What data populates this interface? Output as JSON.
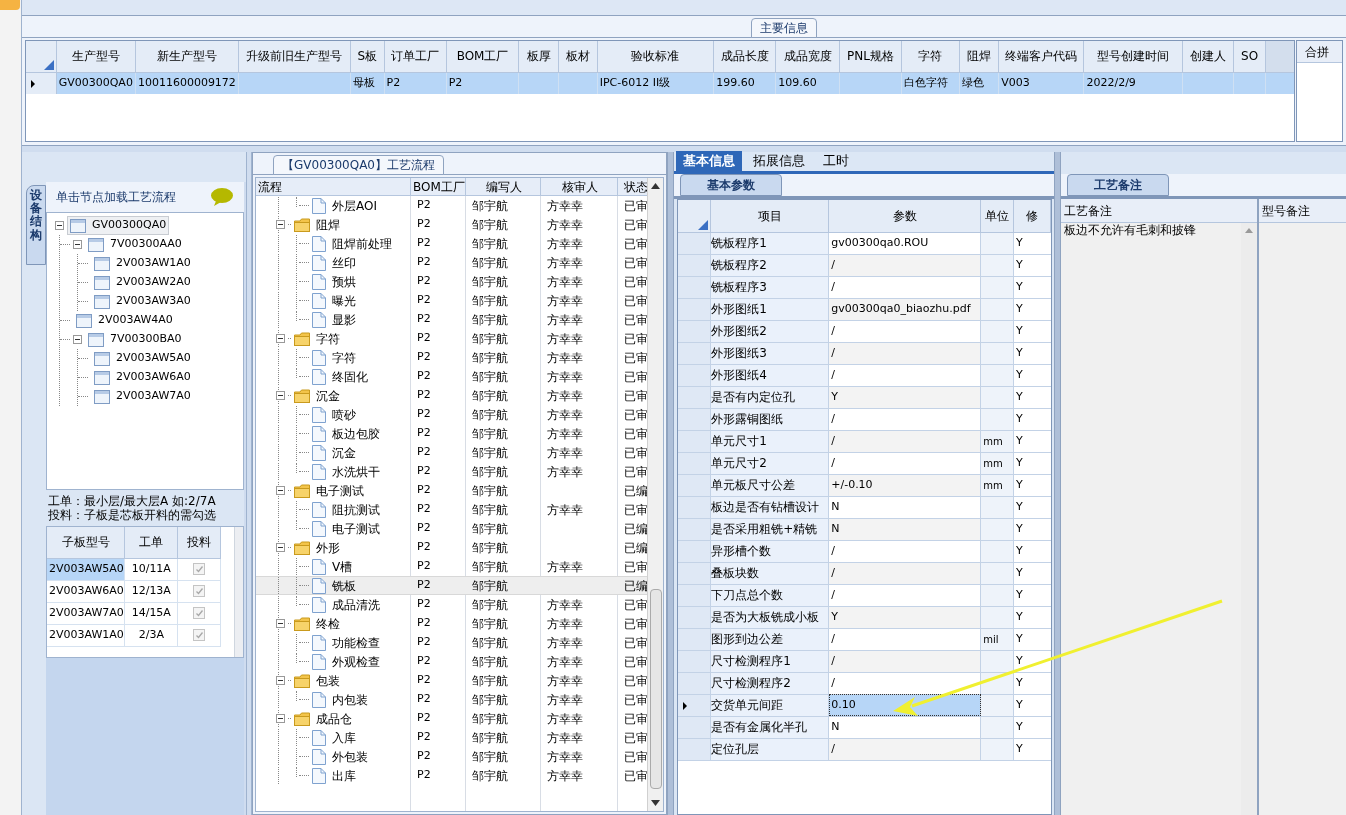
{
  "main_info": {
    "title": "主要信息",
    "columns": [
      "生产型号",
      "新生产型号",
      "升级前旧生产型号",
      "S板",
      "订单工厂",
      "BOM工厂",
      "板厚",
      "板材",
      "验收标准",
      "成品长度",
      "成品宽度",
      "PNL规格",
      "字符",
      "阻焊",
      "终端客户代码",
      "型号创建时间",
      "创建人",
      "SO"
    ],
    "rows": [
      {
        "selected": true,
        "cells": [
          "GV00300QA0",
          "10011600009172",
          "",
          "母板",
          "P2",
          "P2",
          "",
          "",
          "IPC-6012 II级",
          "199.60",
          "109.60",
          "",
          "白色字符",
          "绿色",
          "V003",
          "2022/2/9",
          "",
          ""
        ]
      }
    ]
  },
  "merge_panel": {
    "title": "合拼"
  },
  "structure_tab": {
    "label": "设备结构"
  },
  "structure": {
    "header": "单击节点加载工艺流程",
    "tree": [
      {
        "label": "GV00300QA0",
        "selected": true,
        "expanded": true,
        "children": [
          {
            "label": "7V00300AA0",
            "selected": false,
            "expanded": true,
            "children": [
              {
                "label": "2V003AW1A0",
                "selected": false
              },
              {
                "label": "2V003AW2A0",
                "selected": false
              },
              {
                "label": "2V003AW3A0",
                "selected": false
              }
            ]
          },
          {
            "label": "2V003AW4A0",
            "selected": false
          },
          {
            "label": "7V00300BA0",
            "selected": false,
            "expanded": true,
            "children": [
              {
                "label": "2V003AW5A0",
                "selected": false
              },
              {
                "label": "2V003AW6A0",
                "selected": false
              },
              {
                "label": "2V003AW7A0",
                "selected": false
              }
            ]
          }
        ]
      }
    ]
  },
  "note": [
    "工单：最小层/最大层A 如:2/7A",
    "投料：子板是芯板开料的需勾选"
  ],
  "sub_boards": {
    "columns": [
      "子板型号",
      "工单",
      "投料"
    ],
    "rows": [
      {
        "model": "2V003AW5A0",
        "order": "10/11A",
        "feed": true,
        "selected": true
      },
      {
        "model": "2V003AW6A0",
        "order": "12/13A",
        "feed": true,
        "selected": false
      },
      {
        "model": "2V003AW7A0",
        "order": "14/15A",
        "feed": true,
        "selected": false
      },
      {
        "model": "2V003AW1A0",
        "order": "2/3A",
        "feed": true,
        "selected": false
      }
    ]
  },
  "flow": {
    "title": "【GV00300QA0】工艺流程",
    "columns": [
      "流程",
      "BOM工厂",
      "编写人",
      "核审人",
      "状态"
    ],
    "items": [
      {
        "kind": "continued",
        "children": [
          {
            "name": "外层AOI",
            "bom": "P2",
            "writer": "邹宇航",
            "reviewer": "方幸幸",
            "status": "已审",
            "selected": false
          }
        ]
      },
      {
        "kind": "group",
        "name": "阻焊",
        "bom": "P2",
        "writer": "邹宇航",
        "reviewer": "方幸幸",
        "status": "已审",
        "selected": false,
        "expanded": true,
        "children": [
          {
            "name": "阻焊前处理",
            "bom": "P2",
            "writer": "邹宇航",
            "reviewer": "方幸幸",
            "status": "已审",
            "selected": false
          },
          {
            "name": "丝印",
            "bom": "P2",
            "writer": "邹宇航",
            "reviewer": "方幸幸",
            "status": "已审",
            "selected": false
          },
          {
            "name": "预烘",
            "bom": "P2",
            "writer": "邹宇航",
            "reviewer": "方幸幸",
            "status": "已审",
            "selected": false
          },
          {
            "name": "曝光",
            "bom": "P2",
            "writer": "邹宇航",
            "reviewer": "方幸幸",
            "status": "已审",
            "selected": false
          },
          {
            "name": "显影",
            "bom": "P2",
            "writer": "邹宇航",
            "reviewer": "方幸幸",
            "status": "已审",
            "selected": false
          }
        ]
      },
      {
        "kind": "group",
        "name": "字符",
        "bom": "P2",
        "writer": "邹宇航",
        "reviewer": "方幸幸",
        "status": "已审",
        "selected": false,
        "expanded": true,
        "children": [
          {
            "name": "字符",
            "bom": "P2",
            "writer": "邹宇航",
            "reviewer": "方幸幸",
            "status": "已审",
            "selected": false
          },
          {
            "name": "终固化",
            "bom": "P2",
            "writer": "邹宇航",
            "reviewer": "方幸幸",
            "status": "已审",
            "selected": false
          }
        ]
      },
      {
        "kind": "group",
        "name": "沉金",
        "bom": "P2",
        "writer": "邹宇航",
        "reviewer": "方幸幸",
        "status": "已审",
        "selected": false,
        "expanded": true,
        "children": [
          {
            "name": "喷砂",
            "bom": "P2",
            "writer": "邹宇航",
            "reviewer": "方幸幸",
            "status": "已审",
            "selected": false
          },
          {
            "name": "板边包胶",
            "bom": "P2",
            "writer": "邹宇航",
            "reviewer": "方幸幸",
            "status": "已审",
            "selected": false
          },
          {
            "name": "沉金",
            "bom": "P2",
            "writer": "邹宇航",
            "reviewer": "方幸幸",
            "status": "已审",
            "selected": false
          },
          {
            "name": "水洗烘干",
            "bom": "P2",
            "writer": "邹宇航",
            "reviewer": "方幸幸",
            "status": "已审",
            "selected": false
          }
        ]
      },
      {
        "kind": "group",
        "name": "电子测试",
        "bom": "P2",
        "writer": "邹宇航",
        "status": "已编",
        "selected": false,
        "expanded": true,
        "children": [
          {
            "name": "阻抗测试",
            "bom": "P2",
            "writer": "邹宇航",
            "reviewer": "方幸幸",
            "status": "已审",
            "selected": false
          },
          {
            "name": "电子测试",
            "bom": "P2",
            "writer": "邹宇航",
            "status": "已编",
            "selected": false
          }
        ]
      },
      {
        "kind": "group",
        "name": "外形",
        "bom": "P2",
        "writer": "邹宇航",
        "status": "已编",
        "selected": false,
        "expanded": true,
        "children": [
          {
            "name": "V槽",
            "bom": "P2",
            "writer": "邹宇航",
            "reviewer": "方幸幸",
            "status": "已审",
            "selected": false
          },
          {
            "name": "铣板",
            "bom": "P2",
            "writer": "邹宇航",
            "status": "已编",
            "selected": true
          },
          {
            "name": "成品清洗",
            "bom": "P2",
            "writer": "邹宇航",
            "reviewer": "方幸幸",
            "status": "已审",
            "selected": false
          }
        ]
      },
      {
        "kind": "group",
        "name": "终检",
        "bom": "P2",
        "writer": "邹宇航",
        "reviewer": "方幸幸",
        "status": "已审",
        "selected": false,
        "expanded": true,
        "children": [
          {
            "name": "功能检查",
            "bom": "P2",
            "writer": "邹宇航",
            "reviewer": "方幸幸",
            "status": "已审",
            "selected": false
          },
          {
            "name": "外观检查",
            "bom": "P2",
            "writer": "邹宇航",
            "reviewer": "方幸幸",
            "status": "已审",
            "selected": false
          }
        ]
      },
      {
        "kind": "group",
        "name": "包装",
        "bom": "P2",
        "writer": "邹宇航",
        "reviewer": "方幸幸",
        "status": "已审",
        "selected": false,
        "expanded": true,
        "children": [
          {
            "name": "内包装",
            "bom": "P2",
            "writer": "邹宇航",
            "reviewer": "方幸幸",
            "status": "已审",
            "selected": false
          }
        ]
      },
      {
        "kind": "group",
        "name": "成品仓",
        "bom": "P2",
        "writer": "邹宇航",
        "reviewer": "方幸幸",
        "status": "已审",
        "selected": false,
        "expanded": true,
        "children": [
          {
            "name": "入库",
            "bom": "P2",
            "writer": "邹宇航",
            "reviewer": "方幸幸",
            "status": "已审",
            "selected": false
          },
          {
            "name": "外包装",
            "bom": "P2",
            "writer": "邹宇航",
            "reviewer": "方幸幸",
            "status": "已审",
            "selected": false
          },
          {
            "name": "出库",
            "bom": "P2",
            "writer": "邹宇航",
            "reviewer": "方幸幸",
            "status": "已审",
            "selected": false
          }
        ]
      }
    ]
  },
  "right_tabs": [
    {
      "label": "基本信息",
      "selected": true
    },
    {
      "label": "拓展信息",
      "selected": false
    },
    {
      "label": "工时",
      "selected": false
    }
  ],
  "param_tab": "基本参数",
  "params": {
    "columns": [
      "项目",
      "参数",
      "单位",
      "修"
    ],
    "rows": [
      {
        "item": "铣板程序1",
        "value": "gv00300qa0.ROU",
        "unit": "",
        "modified": "Y",
        "selected": false
      },
      {
        "item": "铣板程序2",
        "value": "/",
        "unit": "",
        "modified": "Y",
        "selected": false
      },
      {
        "item": "铣板程序3",
        "value": "/",
        "unit": "",
        "modified": "Y",
        "selected": false
      },
      {
        "item": "外形图纸1",
        "value": "gv00300qa0_biaozhu.pdf",
        "unit": "",
        "modified": "Y",
        "selected": false
      },
      {
        "item": "外形图纸2",
        "value": "/",
        "unit": "",
        "modified": "Y",
        "selected": false
      },
      {
        "item": "外形图纸3",
        "value": "/",
        "unit": "",
        "modified": "Y",
        "selected": false
      },
      {
        "item": "外形图纸4",
        "value": "/",
        "unit": "",
        "modified": "Y",
        "selected": false
      },
      {
        "item": "是否有内定位孔",
        "value": "Y",
        "unit": "",
        "modified": "Y",
        "selected": false
      },
      {
        "item": "外形露铜图纸",
        "value": "/",
        "unit": "",
        "modified": "Y",
        "selected": false
      },
      {
        "item": "单元尺寸1",
        "value": "/",
        "unit": "mm",
        "modified": "Y",
        "selected": false
      },
      {
        "item": "单元尺寸2",
        "value": "/",
        "unit": "mm",
        "modified": "Y",
        "selected": false
      },
      {
        "item": "单元板尺寸公差",
        "value": "+/-0.10",
        "unit": "mm",
        "modified": "Y",
        "selected": false
      },
      {
        "item": "板边是否有钻槽设计",
        "value": "N",
        "unit": "",
        "modified": "Y",
        "selected": false
      },
      {
        "item": "是否采用粗铣+精铣",
        "value": "N",
        "unit": "",
        "modified": "Y",
        "selected": false
      },
      {
        "item": "异形槽个数",
        "value": "/",
        "unit": "",
        "modified": "Y",
        "selected": false
      },
      {
        "item": "叠板块数",
        "value": "/",
        "unit": "",
        "modified": "Y",
        "selected": false
      },
      {
        "item": "下刀点总个数",
        "value": "/",
        "unit": "",
        "modified": "Y",
        "selected": false
      },
      {
        "item": "是否为大板铣成小板",
        "value": "Y",
        "unit": "",
        "modified": "Y",
        "selected": false
      },
      {
        "item": "图形到边公差",
        "value": "/",
        "unit": "mil",
        "modified": "Y",
        "selected": false
      },
      {
        "item": "尺寸检测程序1",
        "value": "/",
        "unit": "",
        "modified": "Y",
        "selected": false
      },
      {
        "item": "尺寸检测程序2",
        "value": "/",
        "unit": "",
        "modified": "Y",
        "selected": false
      },
      {
        "item": "交货单元间距",
        "value": "0.10",
        "unit": "",
        "modified": "Y",
        "selected": true
      },
      {
        "item": "是否有金属化半孔",
        "value": "N",
        "unit": "",
        "modified": "Y",
        "selected": false
      },
      {
        "item": "定位孔层",
        "value": "/",
        "unit": "",
        "modified": "Y",
        "selected": false
      }
    ]
  },
  "remarks": {
    "tab": "工艺备注",
    "columns": [
      "工艺备注",
      "型号备注"
    ],
    "process_note": "板边不允许有毛刺和披锋"
  }
}
